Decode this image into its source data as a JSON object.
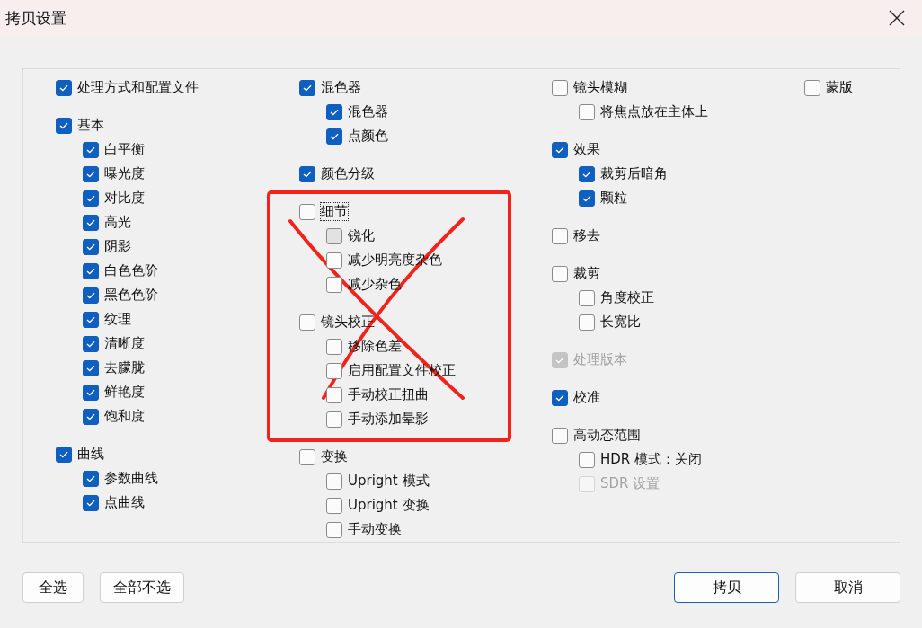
{
  "window": {
    "title": "拷贝设置"
  },
  "columns": [
    {
      "groups": [
        {
          "label": "处理方式和配置文件",
          "checked": true
        },
        {
          "label": "基本",
          "checked": true,
          "children": [
            {
              "label": "白平衡",
              "checked": true
            },
            {
              "label": "曝光度",
              "checked": true
            },
            {
              "label": "对比度",
              "checked": true
            },
            {
              "label": "高光",
              "checked": true
            },
            {
              "label": "阴影",
              "checked": true
            },
            {
              "label": "白色色阶",
              "checked": true
            },
            {
              "label": "黑色色阶",
              "checked": true
            },
            {
              "label": "纹理",
              "checked": true
            },
            {
              "label": "清晰度",
              "checked": true
            },
            {
              "label": "去朦胧",
              "checked": true
            },
            {
              "label": "鲜艳度",
              "checked": true
            },
            {
              "label": "饱和度",
              "checked": true
            }
          ]
        },
        {
          "label": "曲线",
          "checked": true,
          "children": [
            {
              "label": "参数曲线",
              "checked": true
            },
            {
              "label": "点曲线",
              "checked": true
            }
          ]
        }
      ]
    },
    {
      "groups": [
        {
          "label": "混色器",
          "checked": true,
          "children": [
            {
              "label": "混色器",
              "checked": true
            },
            {
              "label": "点颜色",
              "checked": true
            }
          ]
        },
        {
          "label": "颜色分级",
          "checked": true
        },
        {
          "label": "细节",
          "checked": false,
          "focused": true,
          "children": [
            {
              "label": "锐化",
              "checked": false,
              "pressed": true
            },
            {
              "label": "减少明亮度杂色",
              "checked": false
            },
            {
              "label": "减少杂色",
              "checked": false
            }
          ]
        },
        {
          "label": "镜头校正",
          "checked": false,
          "children": [
            {
              "label": "移除色差",
              "checked": false
            },
            {
              "label": "启用配置文件校正",
              "checked": false
            },
            {
              "label": "手动校正扭曲",
              "checked": false
            },
            {
              "label": "手动添加晕影",
              "checked": false
            }
          ]
        },
        {
          "label": "变换",
          "checked": false,
          "children": [
            {
              "label": "Upright 模式",
              "checked": false
            },
            {
              "label": "Upright 变换",
              "checked": false
            },
            {
              "label": "手动变换",
              "checked": false
            }
          ]
        }
      ]
    },
    {
      "groups": [
        {
          "label": "镜头模糊",
          "checked": false,
          "children": [
            {
              "label": "将焦点放在主体上",
              "checked": false
            }
          ]
        },
        {
          "label": "效果",
          "checked": true,
          "children": [
            {
              "label": "裁剪后暗角",
              "checked": true
            },
            {
              "label": "颗粒",
              "checked": true
            }
          ]
        },
        {
          "label": "移去",
          "checked": false
        },
        {
          "label": "裁剪",
          "checked": false,
          "children": [
            {
              "label": "角度校正",
              "checked": false
            },
            {
              "label": "长宽比",
              "checked": false
            }
          ]
        },
        {
          "label": "处理版本",
          "checked": true,
          "disabled": true
        },
        {
          "label": "校准",
          "checked": true
        },
        {
          "label": "高动态范围",
          "checked": false,
          "children": [
            {
              "label": "HDR 模式：关闭",
              "checked": false
            },
            {
              "label": "SDR 设置",
              "checked": false,
              "disabled": true
            }
          ]
        }
      ]
    },
    {
      "groups": [
        {
          "label": "蒙版",
          "checked": false
        }
      ]
    }
  ],
  "annotation": {
    "kind": "crossed-box"
  },
  "buttons_left": [
    {
      "label": "全选"
    },
    {
      "label": "全部不选"
    }
  ],
  "buttons_right": [
    {
      "label": "拷贝",
      "kind": "primary"
    },
    {
      "label": "取消",
      "kind": "normal"
    }
  ]
}
